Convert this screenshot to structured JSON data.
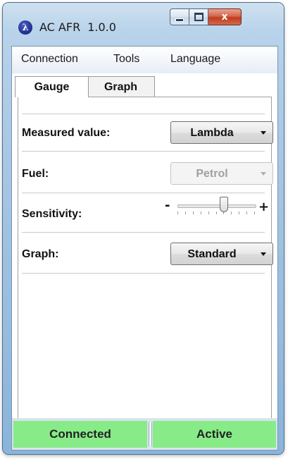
{
  "window": {
    "title": "AC AFR",
    "version": "1.0.0",
    "icon_glyph": "λ",
    "close_glyph": "x"
  },
  "menu": {
    "items": [
      {
        "label": "Connection"
      },
      {
        "label": "Tools"
      },
      {
        "label": "Language"
      }
    ]
  },
  "tabs": [
    {
      "label": "Gauge",
      "selected": true
    },
    {
      "label": "Graph",
      "selected": false
    }
  ],
  "settings": {
    "measured_value": {
      "label": "Measured value:",
      "value": "Lambda",
      "enabled": true
    },
    "fuel": {
      "label": "Fuel:",
      "value": "Petrol",
      "enabled": false
    },
    "sensitivity": {
      "label": "Sensitivity:",
      "minus": "-",
      "plus": "+",
      "level": 0.6
    },
    "graph": {
      "label": "Graph:",
      "value": "Standard",
      "enabled": true
    }
  },
  "status": {
    "connection": "Connected",
    "state": "Active",
    "color": "#87eb88"
  }
}
